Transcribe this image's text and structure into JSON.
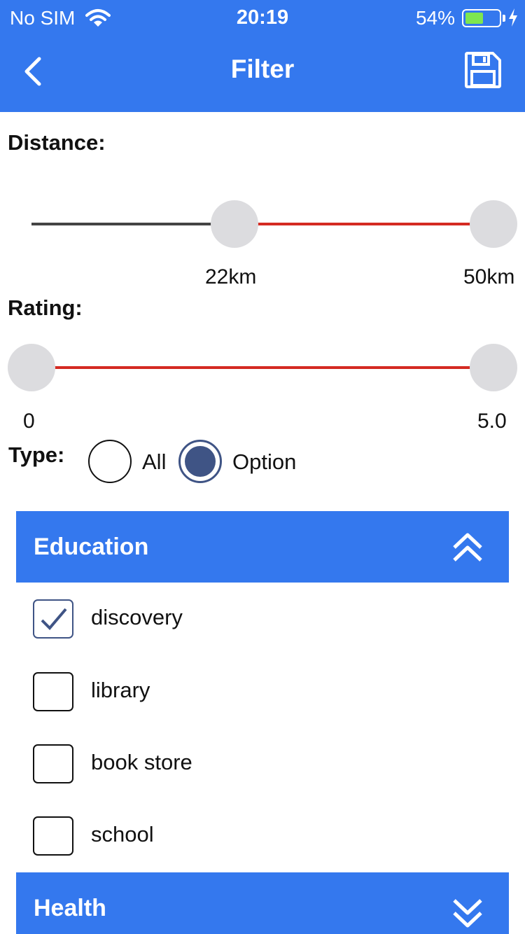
{
  "status": {
    "carrier": "No SIM",
    "time": "20:19",
    "battery_pct": "54%",
    "battery_level": 0.54
  },
  "nav": {
    "title": "Filter",
    "back_icon": "chevron-left-icon",
    "save_icon": "floppy-disk-icon"
  },
  "distance": {
    "label": "Distance:",
    "min": 0,
    "max": 50,
    "low": 22,
    "high": 50,
    "low_label": "22km",
    "high_label": "50km"
  },
  "rating": {
    "label": "Rating:",
    "min": 0,
    "max": 5,
    "low": 0,
    "high": 5,
    "low_label": "0",
    "high_label": "5.0"
  },
  "type": {
    "label": "Type:",
    "options": [
      "All",
      "Option"
    ],
    "selected": "Option"
  },
  "groups": [
    {
      "title": "Education",
      "expanded": true,
      "items": [
        {
          "label": "discovery",
          "checked": true
        },
        {
          "label": "library",
          "checked": false
        },
        {
          "label": "book store",
          "checked": false
        },
        {
          "label": "school",
          "checked": false
        }
      ]
    },
    {
      "title": "Health",
      "expanded": false
    }
  ],
  "colors": {
    "accent": "#3478ee",
    "slider_active": "#d42a22",
    "control": "#3f5485"
  }
}
